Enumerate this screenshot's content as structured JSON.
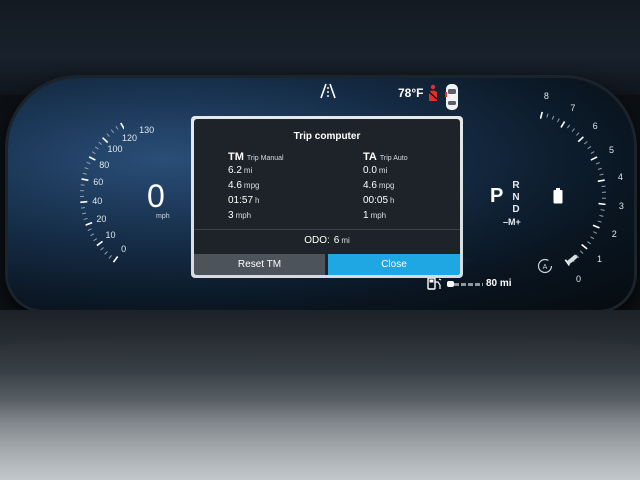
{
  "status_bar": {
    "road_icon": "road-ahead-icon",
    "temperature": "78°F",
    "seatbelt_icon": "seatbelt-warning-icon",
    "car_icon": "car-topview-icon"
  },
  "speedometer": {
    "ticks": [
      "0",
      "10",
      "20",
      "40",
      "60",
      "80",
      "100",
      "120",
      "130"
    ],
    "speed": "0",
    "unit": "mph"
  },
  "tachometer": {
    "ticks": [
      "0",
      "1",
      "2",
      "3",
      "4",
      "5",
      "6",
      "7",
      "8"
    ]
  },
  "gear": {
    "current": "P",
    "options": [
      "R",
      "N",
      "D"
    ],
    "mode": "–M+",
    "battery_icon": "battery-icon",
    "auto_icon": "auto-start-stop-icon"
  },
  "fuel": {
    "icon": "fuel-pump-icon",
    "level_fraction": 0.2,
    "range": "80 mi"
  },
  "trip_computer": {
    "title": "Trip computer",
    "tm": {
      "code": "TM",
      "label": "Trip Manual",
      "distance": "6.2",
      "distance_unit": "mi",
      "economy": "4.6",
      "economy_unit": "mpg",
      "time": "01:57",
      "time_unit": "h",
      "speed": "3",
      "speed_unit": "mph"
    },
    "ta": {
      "code": "TA",
      "label": "Trip Auto",
      "distance": "0.0",
      "distance_unit": "mi",
      "economy": "4.6",
      "economy_unit": "mpg",
      "time": "00:05",
      "time_unit": "h",
      "speed": "1",
      "speed_unit": "mph"
    },
    "odo_label": "ODO:",
    "odo_value": "6",
    "odo_unit": "mi",
    "reset_label": "Reset TM",
    "close_label": "Close"
  }
}
